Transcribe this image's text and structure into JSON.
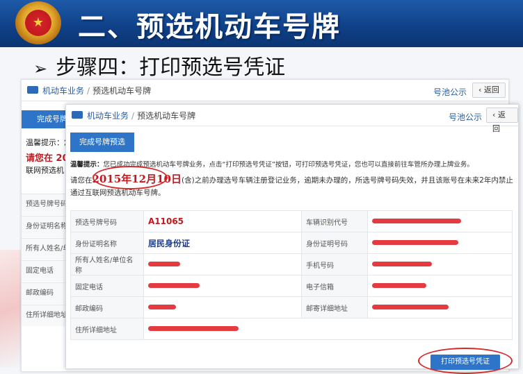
{
  "slide": {
    "title": "二、预选机动车号牌",
    "step": "步骤四：打印预选号凭证"
  },
  "back_window": {
    "breadcrumb_main": "机动车业务",
    "breadcrumb_sub": "预选机动车号牌",
    "pool_link": "号池公示",
    "back_label": "返回",
    "tab_label": "完成号牌",
    "tip_prefix": "温馨提示：您",
    "line2": "请您在 20",
    "line3": "联网预选机",
    "rows": [
      "预选号牌号码",
      "身份证明名称",
      "所有人姓名/单",
      "固定电话",
      "邮政编码",
      "住所详细地址"
    ]
  },
  "front_window": {
    "breadcrumb_main": "机动车业务",
    "breadcrumb_sub": "预选机动车号牌",
    "pool_link": "号池公示",
    "back_label": "返回",
    "tab_label": "完成号牌预选",
    "tip_bold": "温馨提示：",
    "tip_text": "您已成功完成预选机动车号牌业务，点击“打印预选号凭证”按钮，可打印预选号凭证，您也可以直接前往车管所办理上牌业务。",
    "notice_pre": "请您在",
    "notice_date": "2015年12月10日",
    "notice_post": "(含)之前办理选号车辆注册登记业务，逾期未办理的，所选号牌号码失效，并且该账号在未来2年内禁止通过互联网预选机动车号牌。",
    "fields": {
      "plate_label": "预选号牌号码",
      "plate_value": "A11065",
      "vin_label": "车辆识别代号",
      "idname_label": "身份证明名称",
      "idname_value": "居民身份证",
      "idno_label": "身份证明号码",
      "owner_label": "所有人姓名/单位名称",
      "mobile_label": "手机号码",
      "phone_label": "固定电话",
      "email_label": "电子信箱",
      "zip_label": "邮政编码",
      "mail_addr_label": "邮寄详细地址",
      "home_addr_label": "住所详细地址"
    },
    "print_button": "打印预选号凭证"
  },
  "colors": {
    "banner": "#0f3f86",
    "accent": "#2e74c9",
    "highlight": "#d42a2a"
  }
}
